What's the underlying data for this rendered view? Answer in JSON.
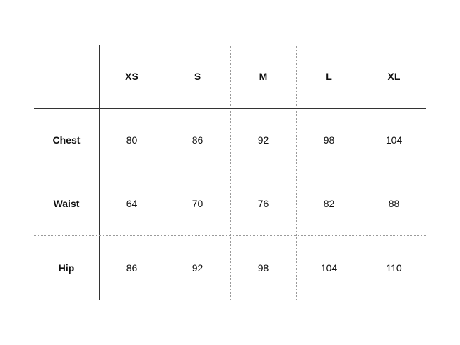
{
  "table": {
    "corner": "",
    "headers": [
      "XS",
      "S",
      "M",
      "L",
      "XL"
    ],
    "rows": [
      {
        "label": "Chest",
        "values": [
          "80",
          "86",
          "92",
          "98",
          "104"
        ]
      },
      {
        "label": "Waist",
        "values": [
          "64",
          "70",
          "76",
          "82",
          "88"
        ]
      },
      {
        "label": "Hip",
        "values": [
          "86",
          "92",
          "98",
          "104",
          "110"
        ]
      }
    ]
  }
}
